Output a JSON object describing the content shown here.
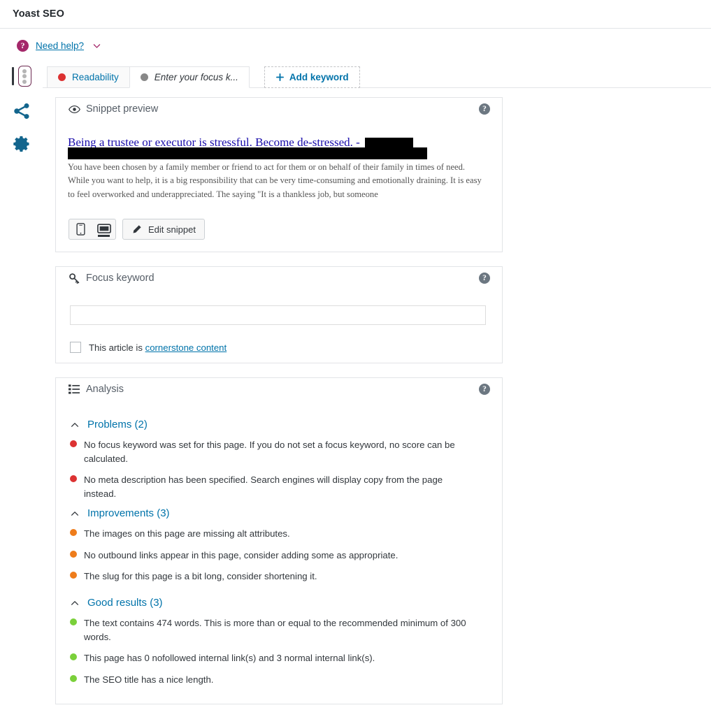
{
  "window": {
    "title": "Yoast SEO"
  },
  "need_help": {
    "icon": "help-circle-icon",
    "label": "Need help?",
    "chevron": "chevron-down-icon"
  },
  "colors": {
    "brand_purple": "#a4286a",
    "link_blue": "#0073aa",
    "bad_red": "#dc3232",
    "ok_orange": "#ee7c1b",
    "good_green": "#7ad03a",
    "neutral_gray": "#888888",
    "rail_blue": "#13658d",
    "snippet_title_blue": "#1a0dab"
  },
  "sidebar": {
    "items": [
      {
        "name": "seo-traffic-light-icon",
        "label": "SEO",
        "selected": true
      },
      {
        "name": "share-icon",
        "label": "Social",
        "selected": false
      },
      {
        "name": "gear-icon",
        "label": "Settings",
        "selected": false
      }
    ]
  },
  "tabs": [
    {
      "label": "Readability",
      "bullet": "#dc3232",
      "active": false,
      "name": "tab-readability"
    },
    {
      "label": "Enter your focus k...",
      "bullet": "#888888",
      "active": true,
      "name": "tab-focus-keyword"
    },
    {
      "label": "Add keyword",
      "icon": "plus-icon",
      "active": false,
      "name": "tab-add-keyword"
    }
  ],
  "snippet": {
    "heading": "Snippet preview",
    "icon": "eye-icon",
    "help": "?",
    "title_text": "Being a trustee or executor is stressful. Become de-stressed. - ",
    "title_redacted": true,
    "url_redacted": true,
    "description": "You have been chosen by a family member or friend to act for them or on behalf of their family in times of need. While you want to help, it is a big responsibility that can be very time-consuming and emotionally draining. It is easy to feel overworked and underappreciated. The saying \"It is a thankless job, but someone",
    "device_toggle": [
      {
        "name": "mobile-preview-icon",
        "selected": false
      },
      {
        "name": "desktop-preview-icon",
        "selected": true
      }
    ],
    "edit_button": {
      "label": "Edit snippet",
      "icon": "pencil-icon"
    }
  },
  "focus_keyword": {
    "heading": "Focus keyword",
    "icon": "key-icon",
    "help": "?",
    "input_value": "",
    "input_placeholder": "",
    "cornerstone": {
      "checked": false,
      "prefix": "This article is ",
      "link": "cornerstone content"
    }
  },
  "analysis": {
    "heading": "Analysis",
    "icon": "list-icon",
    "help": "?",
    "groups": [
      {
        "title": "Problems (2)",
        "collapse_icon": "chevron-up-icon",
        "bullet": "#dc3232",
        "items": [
          "No focus keyword was set for this page. If you do not set a focus keyword, no score can be calculated.",
          "No meta description has been specified. Search engines will display copy from the page instead."
        ]
      },
      {
        "title": "Improvements (3)",
        "collapse_icon": "chevron-up-icon",
        "bullet": "#ee7c1b",
        "items": [
          "The images on this page are missing alt attributes.",
          "No outbound links appear in this page, consider adding some as appropriate.",
          "The slug for this page is a bit long, consider shortening it."
        ]
      },
      {
        "title": "Good results (3)",
        "collapse_icon": "chevron-up-icon",
        "bullet": "#7ad03a",
        "items": [
          "The text contains 474 words. This is more than or equal to the recommended minimum of 300 words.",
          "This page has 0 nofollowed internal link(s) and 3 normal internal link(s).",
          "The SEO title has a nice length."
        ]
      }
    ]
  }
}
